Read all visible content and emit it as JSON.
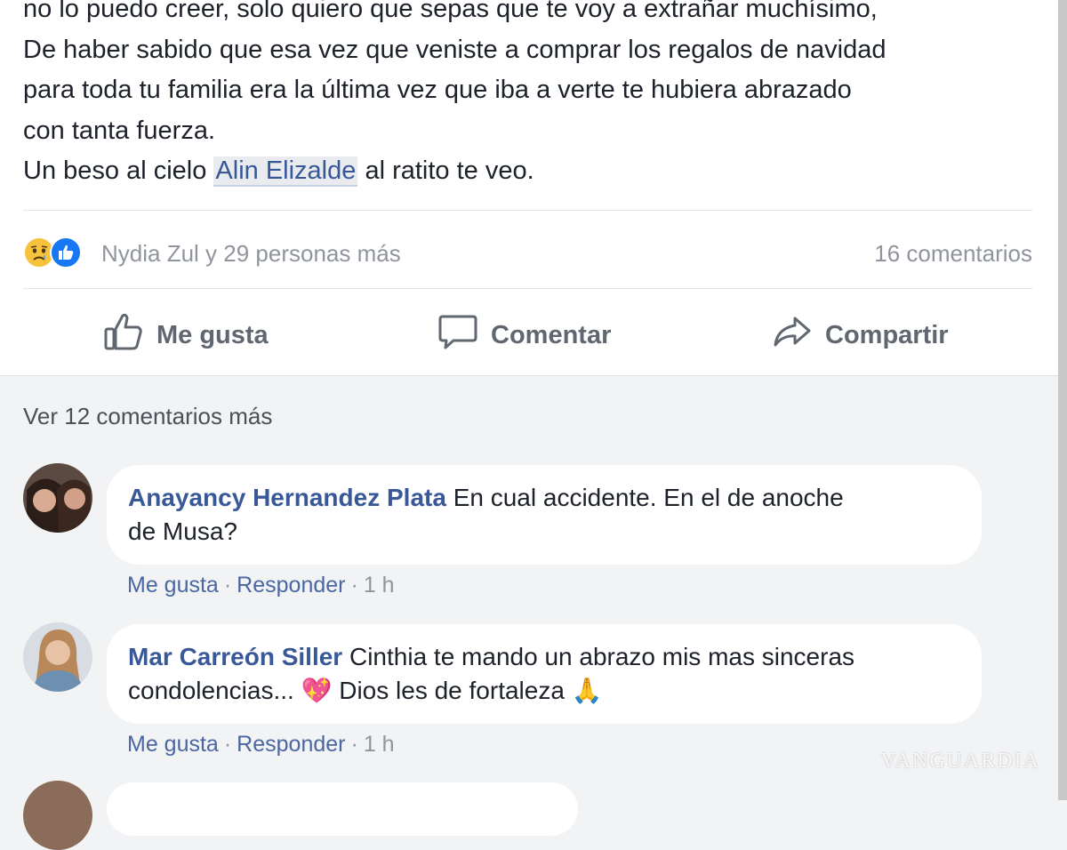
{
  "post": {
    "lines": [
      "no lo puedo creer, solo quiero que sepas que te voy a extrañar muchísimo,",
      "De haber sabido que esa vez que veniste a comprar los regalos de navidad",
      "para toda tu familia era la última vez que iba a verte te hubiera abrazado",
      "con tanta fuerza."
    ],
    "last_line": {
      "before": "Un beso al cielo ",
      "mention": "Alin Elizalde",
      "after": " al ratito te veo."
    }
  },
  "reactions": {
    "icons": [
      "sad-reaction-icon",
      "like-reaction-icon"
    ],
    "summary": "Nydia Zul y 29 personas más",
    "comment_count": "16 comentarios"
  },
  "actions": {
    "like": "Me gusta",
    "comment": "Comentar",
    "share": "Compartir"
  },
  "comments_section": {
    "more_link": "Ver 12 comentarios más",
    "comments": [
      {
        "author": "Anayancy Hernandez Plata",
        "text_line1": "En cual accidente. En el de anoche",
        "text_line2": "de Musa?",
        "like": "Me gusta",
        "reply": "Responder",
        "time": "1 h"
      },
      {
        "author": "Mar Carreón Siller",
        "text_line1": "Cinthia te mando un abrazo mis mas sinceras",
        "text_line2_a": "condolencias...",
        "text_line2_b": "Dios les de fortaleza",
        "emoji_heart": "💖",
        "emoji_pray": "🙏",
        "like": "Me gusta",
        "reply": "Responder",
        "time": "1 h"
      }
    ]
  },
  "meta_separator": "·",
  "watermark": "VANGUARDIA",
  "colors": {
    "link_blue": "#385898",
    "muted": "#90949c",
    "like_blue": "#1877f2",
    "sad_yellow": "#f7c33c"
  }
}
